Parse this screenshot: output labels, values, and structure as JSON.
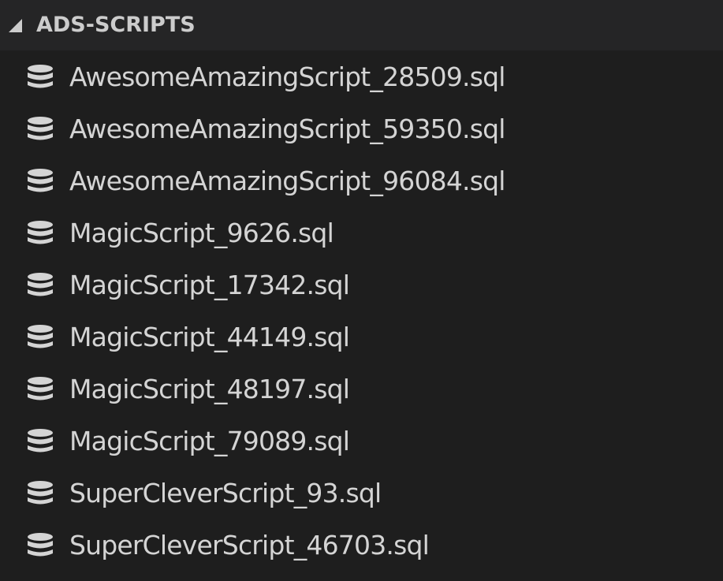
{
  "section": {
    "title": "ADS-SCRIPTS",
    "twistie_icon": "chevron-expanded-icon"
  },
  "colors": {
    "header_background": "#252526",
    "list_background": "#1e1e1e",
    "header_text": "#cccccc",
    "item_text": "#d4d4d4",
    "icon": "#d4d4d4"
  },
  "files": [
    {
      "label": "AwesomeAmazingScript_28509.sql",
      "icon": "database-icon"
    },
    {
      "label": "AwesomeAmazingScript_59350.sql",
      "icon": "database-icon"
    },
    {
      "label": "AwesomeAmazingScript_96084.sql",
      "icon": "database-icon"
    },
    {
      "label": "MagicScript_9626.sql",
      "icon": "database-icon"
    },
    {
      "label": "MagicScript_17342.sql",
      "icon": "database-icon"
    },
    {
      "label": "MagicScript_44149.sql",
      "icon": "database-icon"
    },
    {
      "label": "MagicScript_48197.sql",
      "icon": "database-icon"
    },
    {
      "label": "MagicScript_79089.sql",
      "icon": "database-icon"
    },
    {
      "label": "SuperCleverScript_93.sql",
      "icon": "database-icon"
    },
    {
      "label": "SuperCleverScript_46703.sql",
      "icon": "database-icon"
    }
  ]
}
